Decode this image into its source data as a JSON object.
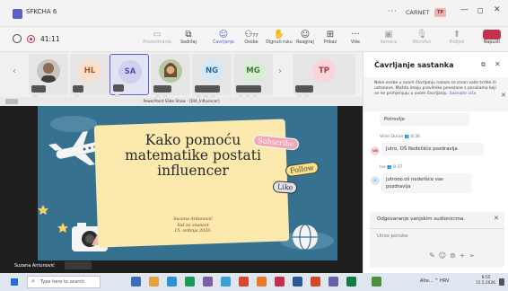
{
  "window": {
    "title": "SFKCHA 6",
    "more_label": "···",
    "account_label": "CARNET",
    "avatar_initials": "TP",
    "minimize_glyph": "—",
    "maximize_glyph": "◻",
    "close_glyph": "✕"
  },
  "toolbar": {
    "meeting_time": "41:11",
    "tools": [
      {
        "label": "Prezentiranje",
        "icon": "present-icon"
      },
      {
        "label": "Sadržaj",
        "icon": "content-icon"
      },
      {
        "label": "Čavrljanje",
        "icon": "chat-icon",
        "active": true
      },
      {
        "label": "Osobe",
        "icon": "people-icon",
        "count": "77"
      },
      {
        "label": "Dignuti ruku",
        "icon": "raise-hand-icon"
      },
      {
        "label": "Reagiraj",
        "icon": "react-icon"
      },
      {
        "label": "Prikaz",
        "icon": "view-icon"
      },
      {
        "label": "Više",
        "icon": "more-icon"
      },
      {
        "label": "Kamera",
        "icon": "camera-icon",
        "disabled": true
      },
      {
        "label": "Mikrofon",
        "icon": "mic-icon",
        "disabled": true
      },
      {
        "label": "Podijeli",
        "icon": "share-icon",
        "disabled": true
      }
    ],
    "leave_label": "Napusti"
  },
  "participants": [
    {
      "initials": "",
      "type": "photo"
    },
    {
      "initials": "HL",
      "bg": "#f8e0cd",
      "fg": "#a65a2b"
    },
    {
      "initials": "SA",
      "bg": "#cfd2ee",
      "fg": "#4f52b2",
      "selected": true
    },
    {
      "initials": "",
      "type": "photo"
    },
    {
      "initials": "NG",
      "bg": "#d5e8f7",
      "fg": "#2c6aa0"
    },
    {
      "initials": "MG",
      "bg": "#d9edd5",
      "fg": "#3e7b35"
    },
    {
      "initials": "TP",
      "bg": "#f8d5d9",
      "fg": "#b3364a"
    }
  ],
  "presentation": {
    "caption": "PowerPoint Slide Show - [DIA_Influencer]",
    "slide_title": "Kako pomoću matematike postati influencer",
    "author_line1": "Suzana Antunović",
    "author_line2": "Sat za znanost",
    "author_line3": "15. svibnja 2026.",
    "sticker_subscribe": "Subscribe",
    "sticker_follow": "Follow",
    "sticker_like": "Like",
    "presenter_name": "Suzana Antunović"
  },
  "chat": {
    "title": "Čavrljanje sastanka",
    "notice": "Neke osobe u ovom čavrljanju nalaze se izvan vaše tvrtke ili ustanove. Možda imaju pravilnike povezane s porukama koji se ne primjenjuju u ovom čavrljanju.",
    "notice_link": "Saznajte više",
    "messages": [
      {
        "text": "Potrovlje"
      },
      {
        "author": "Vilim Duran",
        "time": "8:36",
        "initials": "VD",
        "av_bg": "#f8d5d9",
        "av_fg": "#b3364a",
        "text": "Jutro, OŠ Nedelišće pozdravlja"
      },
      {
        "author": "Ivo",
        "time": "8:37",
        "initials": "I",
        "av_bg": "#d5e8f7",
        "av_fg": "#2c6aa0",
        "text": "jutrooo.oš nedelišće vas pozdravlja"
      }
    ],
    "reply_label": "Odgovaranje vanjskim sudionicima.",
    "input_placeholder": "Unos poruke"
  },
  "taskbar": {
    "search_placeholder": "Type here to search",
    "tray_text": "Alte... ^ HRV",
    "clock_time": "8:55",
    "clock_date": "15.5.2026."
  }
}
